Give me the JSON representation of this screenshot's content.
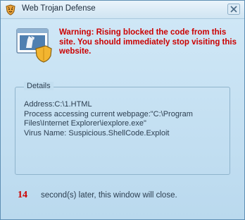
{
  "window": {
    "title": "Web Trojan Defense",
    "close_icon": "close-icon",
    "app_icon": "tiger-shield-icon"
  },
  "warning": {
    "message": "Warning: Rising blocked the code from this site. You should immediately stop visiting this website."
  },
  "details": {
    "legend": "Details",
    "address": "Address:C:\\1.HTML",
    "process": "Process accessing current webpage:\"C:\\Program Files\\Internet Explorer\\iexplore.exe\"",
    "virus": "Virus Name: Suspicious.ShellCode.Exploit"
  },
  "countdown": {
    "seconds": "14",
    "text": "second(s) later, this window will close."
  },
  "colors": {
    "warning_red": "#cc0000",
    "background": "#c9e3f3",
    "border": "#5f8fb4"
  }
}
